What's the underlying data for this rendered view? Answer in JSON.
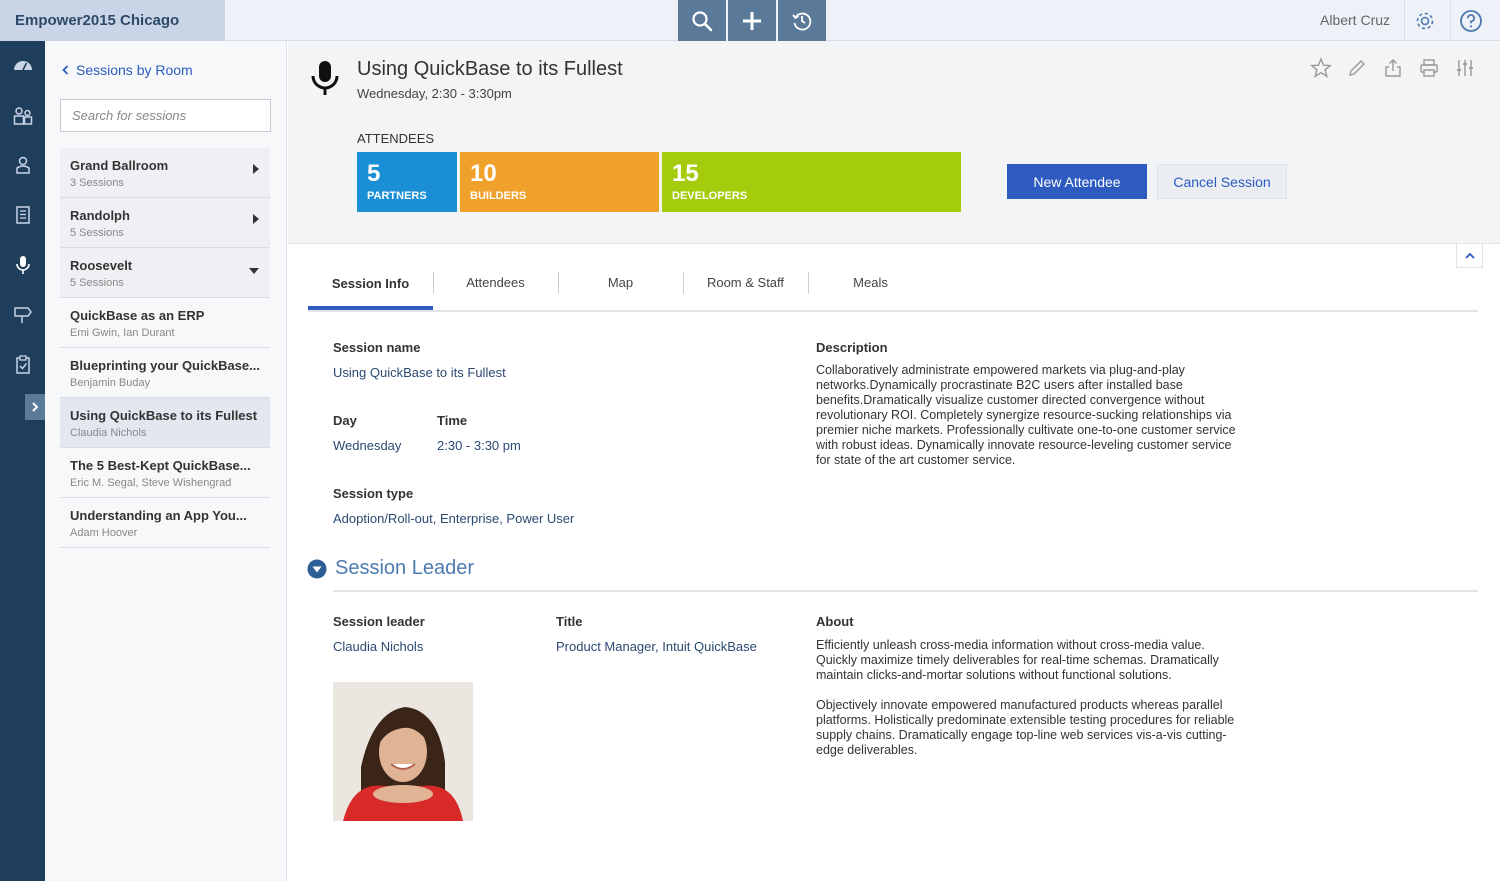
{
  "app": {
    "title": "Empower2015 Chicago",
    "user": "Albert Cruz"
  },
  "sidebar": {
    "back_label": "Sessions by Room",
    "search_placeholder": "Search for sessions",
    "items": [
      {
        "name": "Grand Ballroom",
        "sub": "3 Sessions",
        "kind": "room",
        "caret": "right"
      },
      {
        "name": "Randolph",
        "sub": "5 Sessions",
        "kind": "room",
        "caret": "right"
      },
      {
        "name": "Roosevelt",
        "sub": "5 Sessions",
        "kind": "room",
        "caret": "down"
      },
      {
        "name": "QuickBase as an ERP",
        "sub": "Emi Gwin, Ian Durant",
        "kind": "session"
      },
      {
        "name": "Blueprinting your QuickBase...",
        "sub": "Benjamin Buday",
        "kind": "session"
      },
      {
        "name": "Using QuickBase to its Fullest",
        "sub": "Claudia Nichols",
        "kind": "session",
        "active": true
      },
      {
        "name": "The 5 Best-Kept QuickBase...",
        "sub": "Eric M. Segal, Steve Wishengrad",
        "kind": "session"
      },
      {
        "name": "Understanding an App You...",
        "sub": "Adam Hoover",
        "kind": "session"
      }
    ]
  },
  "header": {
    "title": "Using QuickBase to its Fullest",
    "when": "Wednesday, 2:30 - 3:30pm",
    "attendees_label": "ATTENDEES",
    "attendees": [
      {
        "count": "5",
        "label": "PARTNERS",
        "color": "#1a8fd6"
      },
      {
        "count": "10",
        "label": "BUILDERS",
        "color": "#f0a12c"
      },
      {
        "count": "15",
        "label": "DEVELOPERS",
        "color": "#a4cc0c"
      }
    ],
    "new_attendee": "New Attendee",
    "cancel_session": "Cancel Session"
  },
  "tabs": [
    "Session Info",
    "Attendees",
    "Map",
    "Room & Staff",
    "Meals"
  ],
  "info": {
    "session_name_label": "Session name",
    "session_name": "Using QuickBase to its Fullest",
    "day_label": "Day",
    "day": "Wednesday",
    "time_label": "Time",
    "time": "2:30 - 3:30 pm",
    "type_label": "Session type",
    "type": "Adoption/Roll-out, Enterprise, Power User",
    "description_label": "Description",
    "description_lines": [
      "Collaboratively administrate empowered markets via plug-and-play",
      "networks.Dynamically procrastinate B2C users after installed base",
      "benefits.Dramatically visualize customer directed convergence without",
      "revolutionary ROI. Completely synergize resource-sucking relationships via",
      "premier niche markets. Professionally cultivate one-to-one customer service",
      "with robust ideas. Dynamically innovate resource-leveling customer service",
      "for state of the art customer service."
    ]
  },
  "leader": {
    "section_title": "Session Leader",
    "leader_label": "Session leader",
    "leader": "Claudia Nichols",
    "title_label": "Title",
    "title": "Product Manager, Intuit QuickBase",
    "about_label": "About",
    "about_p1": [
      "Efficiently unleash cross-media information without cross-media value.",
      "Quickly maximize timely deliverables for real-time schemas. Dramatically",
      "maintain clicks-and-mortar solutions without functional solutions."
    ],
    "about_p2": [
      "Objectively innovate empowered manufactured products whereas parallel",
      "platforms. Holistically predominate extensible testing procedures for reliable",
      "supply chains. Dramatically engage top-line web services vis-a-vis cutting-",
      "edge deliverables."
    ]
  }
}
